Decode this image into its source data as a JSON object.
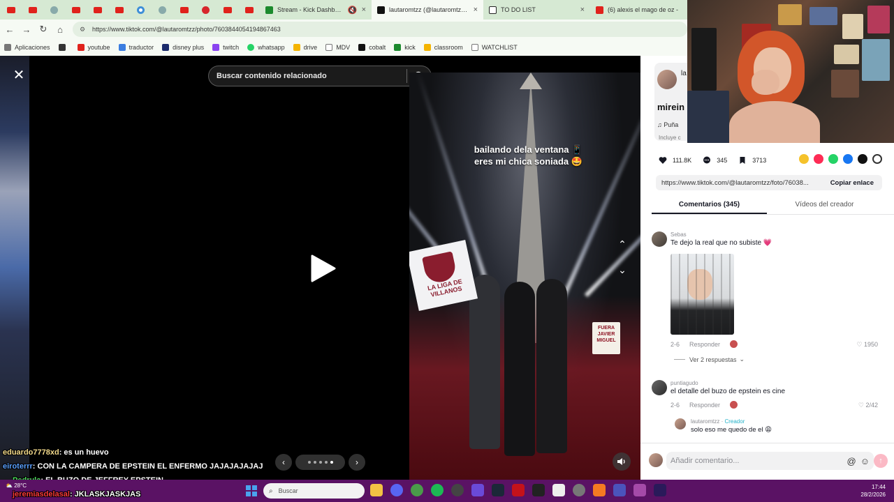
{
  "browser": {
    "tabs": [
      {
        "label": "Stream - Kick Dashboard",
        "icon": "kick-icon",
        "color": "#1b8a2d"
      },
      {
        "label": "lautaromtzz (@lautaromtzz) | T",
        "icon": "tiktok-icon",
        "color": "#111111",
        "active": true
      },
      {
        "label": "TO DO LIST",
        "icon": "notion-icon",
        "color": "#222222"
      },
      {
        "label": "(6) alexis el mago de oz -",
        "icon": "youtube-icon",
        "color": "#e0221c"
      }
    ],
    "url": "https://www.tiktok.com/@lautaromtzz/photo/7603844054194867463",
    "bookmarks": [
      {
        "label": "Aplicaciones",
        "icon": "apps-grid-icon",
        "color": "#555555"
      },
      {
        "label": "",
        "icon": "grid-icon",
        "color": "#333333"
      },
      {
        "label": "youtube",
        "icon": "youtube-icon",
        "color": "#e0221c"
      },
      {
        "label": "traductor",
        "icon": "translate-icon",
        "color": "#3b7de0"
      },
      {
        "label": "disney plus",
        "icon": "disney-icon",
        "color": "#1b2b6b"
      },
      {
        "label": "twitch",
        "icon": "twitch-icon",
        "color": "#8a44f0"
      },
      {
        "label": "whatsapp",
        "icon": "whatsapp-icon",
        "color": "#25d366"
      },
      {
        "label": "drive",
        "icon": "drive-icon",
        "color": "#f4b400"
      },
      {
        "label": "MDV",
        "icon": "folder-icon",
        "color": "#777777"
      },
      {
        "label": "cobalt",
        "icon": "cobalt-icon",
        "color": "#111111"
      },
      {
        "label": "kick",
        "icon": "kick-icon",
        "color": "#1b8a2d"
      },
      {
        "label": "classroom",
        "icon": "classroom-icon",
        "color": "#f4b400"
      },
      {
        "label": "WATCHLIST",
        "icon": "folder-icon",
        "color": "#777777"
      }
    ]
  },
  "viewer": {
    "search_placeholder": "Buscar contenido relacionado",
    "caption_line1": "bailando dela ventana 📱",
    "caption_line2": "eres mi chica soniada 🤩",
    "flag_text": "LA LIGA DE VILLANOS",
    "sign_text": "FUERA JAVIER MIGUEL",
    "slide_count": 5,
    "active_slide": 5
  },
  "panel": {
    "author_username": "la",
    "post_title": "mirein",
    "music": "♫  Puña",
    "includes": "Incluye c",
    "likes": "111.8K",
    "comments": "345",
    "saves": "3713",
    "link_url": "https://www.tiktok.com/@lautaromtzz/foto/76038...",
    "copy_link": "Copiar enlace",
    "tab_comments": "Comentarios (345)",
    "tab_creator": "Vídeos del creador",
    "comment1": {
      "user": "Sebas",
      "text": "Te dejo la real que no subiste 💗",
      "date": "2-6",
      "reply": "Responder",
      "likes": "1950",
      "view_replies": "Ver 2 respuestas"
    },
    "comment2": {
      "user": "puntiagudo",
      "text": "el detalle del buzo de epstein es cine",
      "date": "2-6",
      "reply": "Responder",
      "likes": "2/42"
    },
    "reply1": {
      "user": "lautaromtzz",
      "badge": "Creador",
      "text": "solo eso me quedo de el 😩"
    },
    "comment_placeholder": "Añadir comentario..."
  },
  "chat": [
    {
      "user": "eduardo7778xd",
      "user_color": "#f2d98a",
      "text": ": es un huevo"
    },
    {
      "user": "eiroterrr",
      "user_color": "#5aa0ff",
      "text": ": CON LA CAMPERA DE EPSTEIN EL ENFERMO JAJAJAJAJAJ"
    },
    {
      "user": "Pedrula",
      "user_color": "#4be05a",
      "text": ": EL BUZO DE JEFFREY EPSTEIN"
    },
    {
      "user": "jeremiasdelasal",
      "user_color": "#ff3a3a",
      "text": ": JKLASKJASKJAS"
    }
  ],
  "taskbar": {
    "weather": "28°C",
    "search_placeholder": "Buscar",
    "time": "17:44",
    "date": "28/2/2026"
  }
}
